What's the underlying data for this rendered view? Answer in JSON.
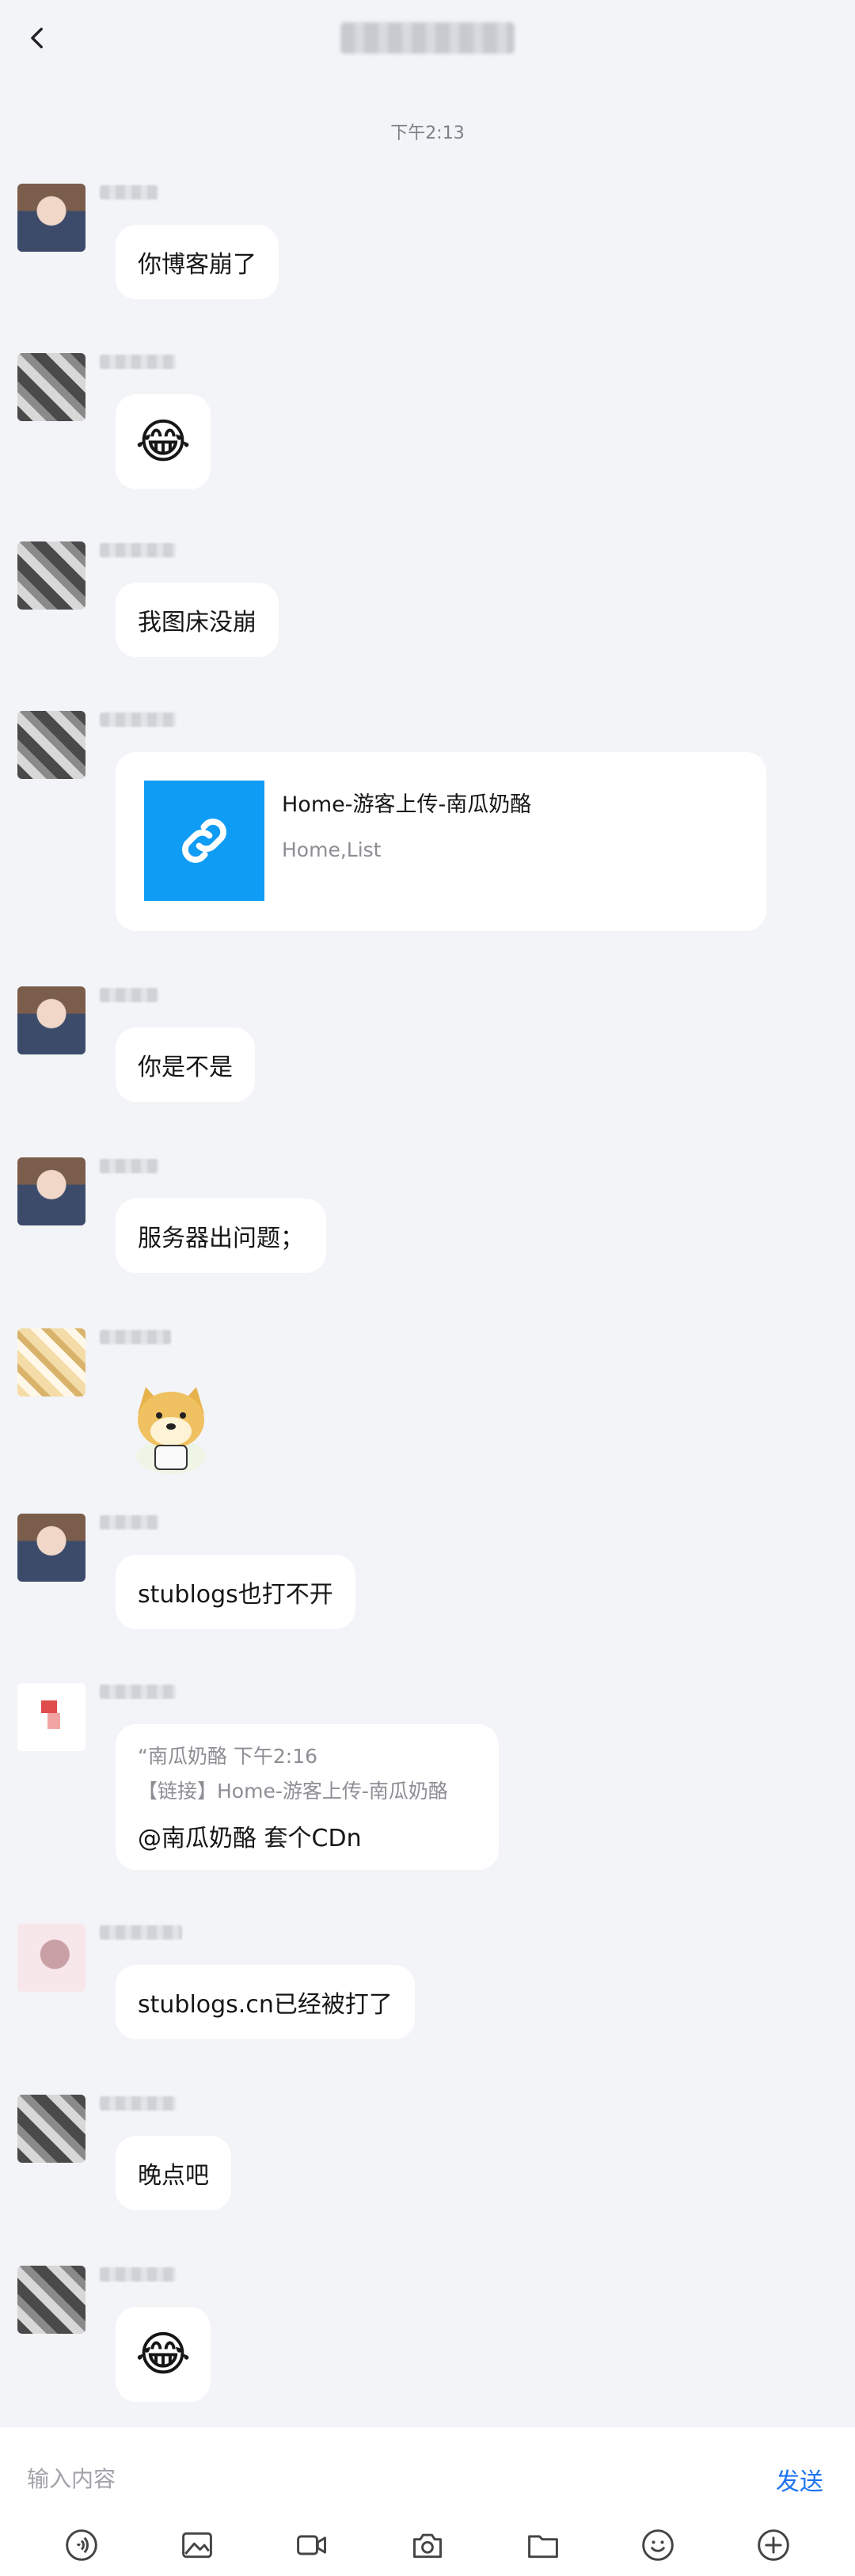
{
  "header": {
    "back_icon": "chevron-left-icon"
  },
  "timestamp": "下午2:13",
  "messages": [
    {
      "type": "text",
      "text": "你博客崩了"
    },
    {
      "type": "emoji",
      "emoji": "😂"
    },
    {
      "type": "text",
      "text": "我图床没崩"
    },
    {
      "type": "link",
      "title": "Home-游客上传-南瓜奶酪",
      "subtitle": "Home,List",
      "icon": "link-icon"
    },
    {
      "type": "text",
      "text": "你是不是"
    },
    {
      "type": "text",
      "text": "服务器出问题；"
    },
    {
      "type": "sticker",
      "sticker": "doge-sticker"
    },
    {
      "type": "text",
      "text": "stublogs也打不开"
    },
    {
      "type": "quote",
      "quote_head": "“南瓜奶酪 下午2:16",
      "quote_sub": "【链接】Home-游客上传-南瓜奶酪",
      "text": "@南瓜奶酪 套个CDn"
    },
    {
      "type": "text",
      "text": "stublogs.cn已经被打了"
    },
    {
      "type": "text",
      "text": "晚点吧"
    },
    {
      "type": "emoji",
      "emoji": "😂"
    }
  ],
  "input": {
    "placeholder": "输入内容",
    "send_label": "发送"
  },
  "toolbar": [
    "voice-icon",
    "image-icon",
    "video-icon",
    "camera-icon",
    "folder-icon",
    "emoji-icon",
    "plus-icon"
  ]
}
